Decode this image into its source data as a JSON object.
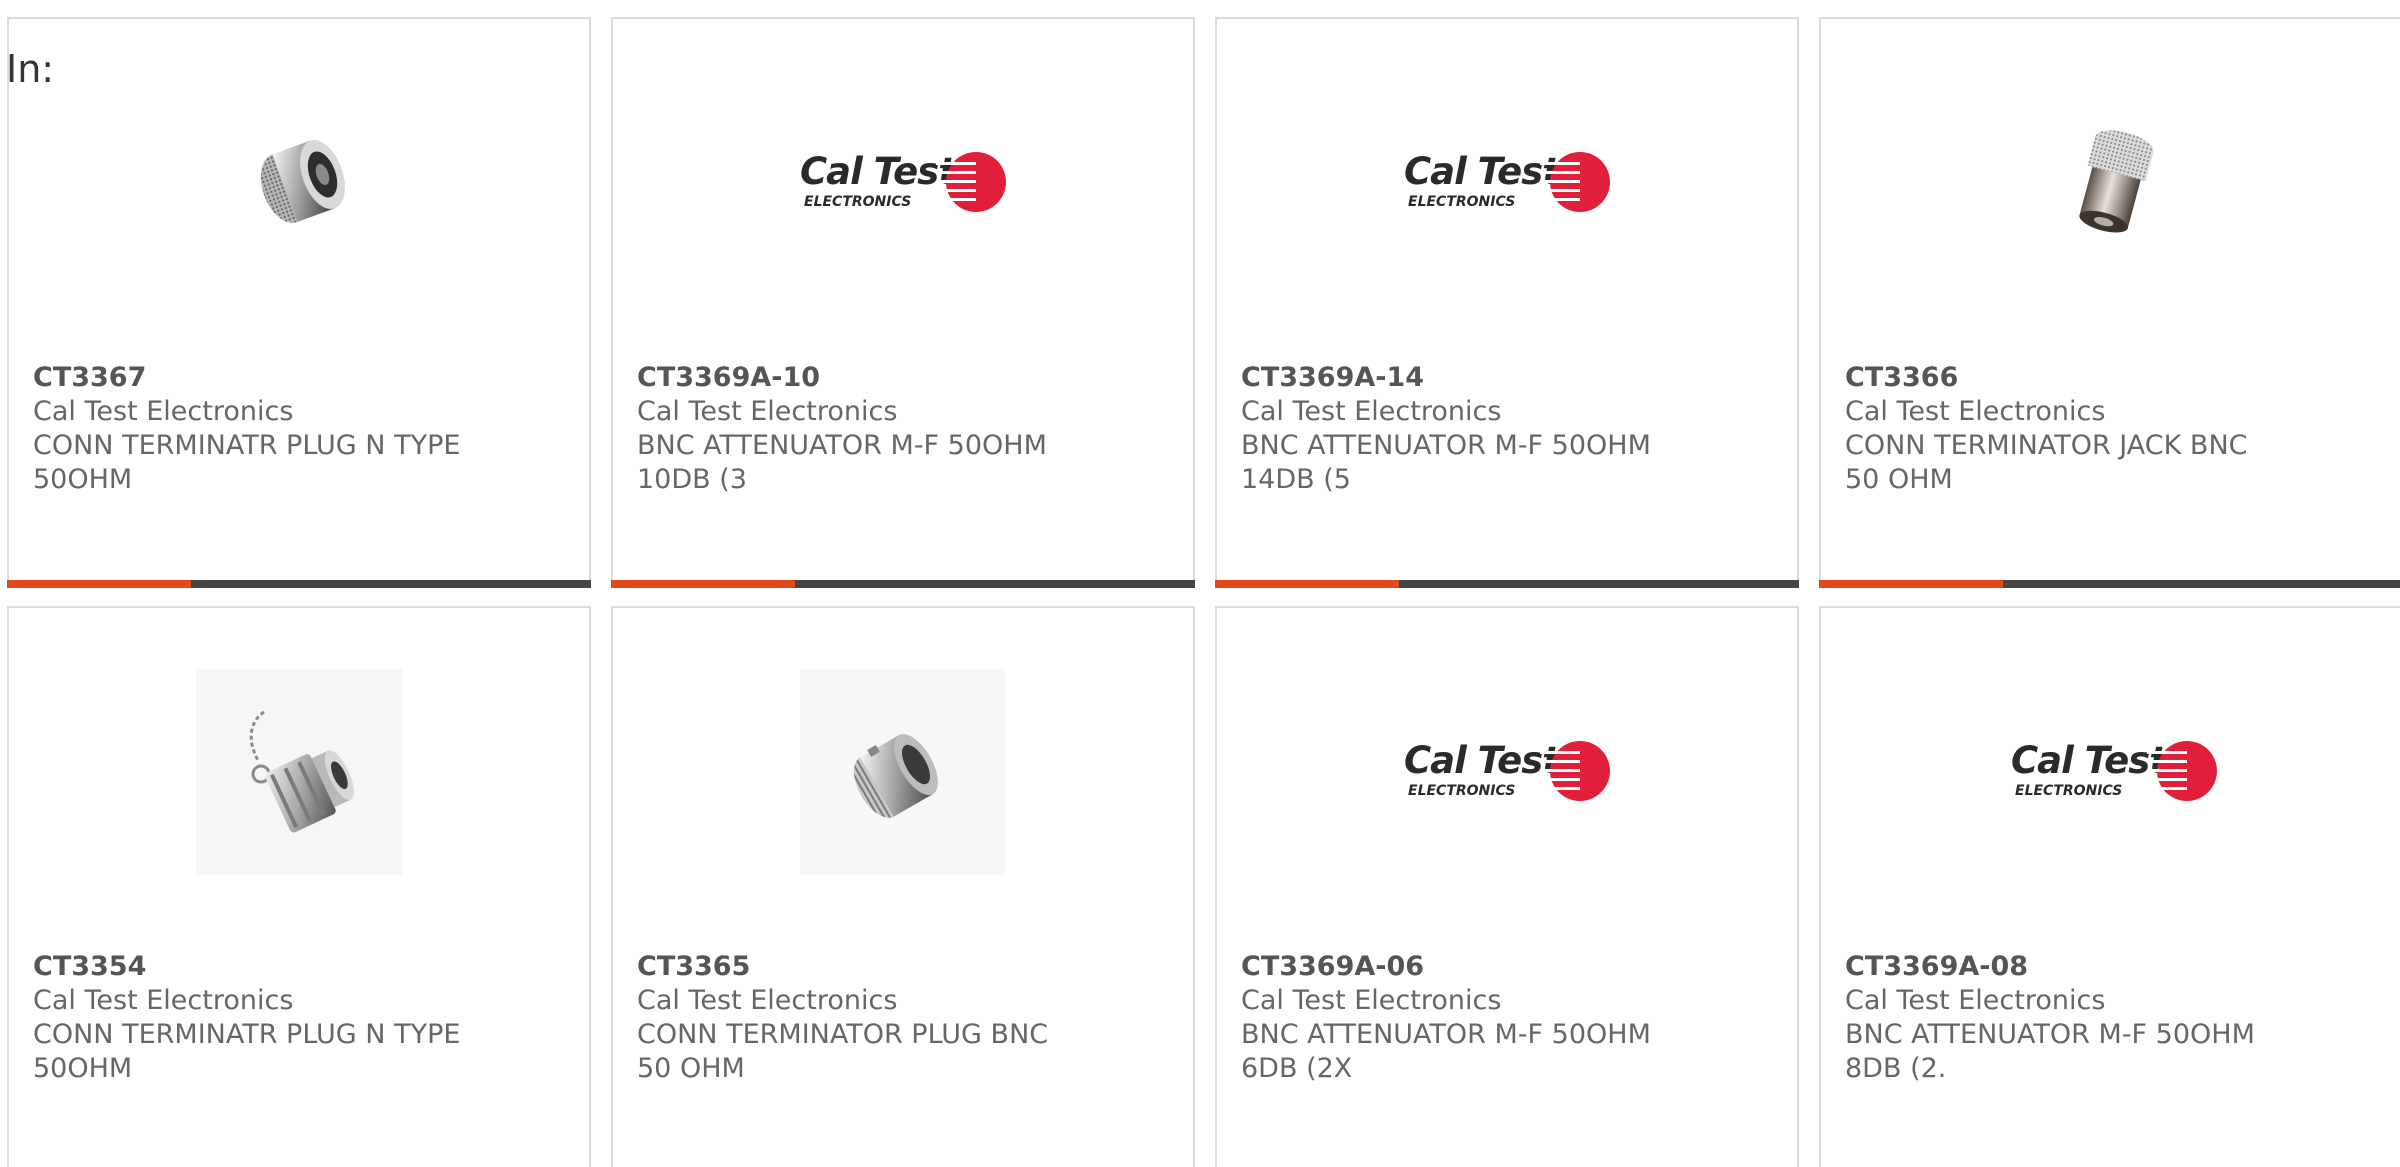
{
  "header": {
    "label": "In:"
  },
  "products": [
    {
      "part": "CT3367",
      "mfr": "Cal Test Electronics",
      "desc": "CONN TERMINATR PLUG N TYPE 50OHM",
      "image": "n-type-plug-terminator-photo"
    },
    {
      "part": "CT3369A-10",
      "mfr": "Cal Test Electronics",
      "desc": "BNC ATTENUATOR M-F 50OHM 10DB (3",
      "image": "cal-test-logo"
    },
    {
      "part": "CT3369A-14",
      "mfr": "Cal Test Electronics",
      "desc": "BNC ATTENUATOR M-F 50OHM 14DB (5",
      "image": "cal-test-logo"
    },
    {
      "part": "CT3366",
      "mfr": "Cal Test Electronics",
      "desc": "CONN TERMINATOR JACK BNC 50 OHM",
      "image": "bnc-jack-terminator-photo"
    },
    {
      "part": "CT3354",
      "mfr": "Cal Test Electronics",
      "desc": "CONN TERMINATR PLUG N TYPE 50OHM",
      "image": "n-type-plug-with-chain-photo"
    },
    {
      "part": "CT3365",
      "mfr": "Cal Test Electronics",
      "desc": "CONN TERMINATOR PLUG BNC 50 OHM",
      "image": "bnc-plug-terminator-photo"
    },
    {
      "part": "CT3369A-06",
      "mfr": "Cal Test Electronics",
      "desc": "BNC ATTENUATOR M-F 50OHM 6DB (2X",
      "image": "cal-test-logo"
    },
    {
      "part": "CT3369A-08",
      "mfr": "Cal Test Electronics",
      "desc": "BNC ATTENUATOR M-F 50OHM 8DB (2.",
      "image": "cal-test-logo"
    }
  ],
  "logo": {
    "word": "Cal Test",
    "sub": "ELECTRONICS"
  },
  "colors": {
    "accent": "#e04a1c",
    "bar": "#444444",
    "logo_red": "#e0203a"
  }
}
